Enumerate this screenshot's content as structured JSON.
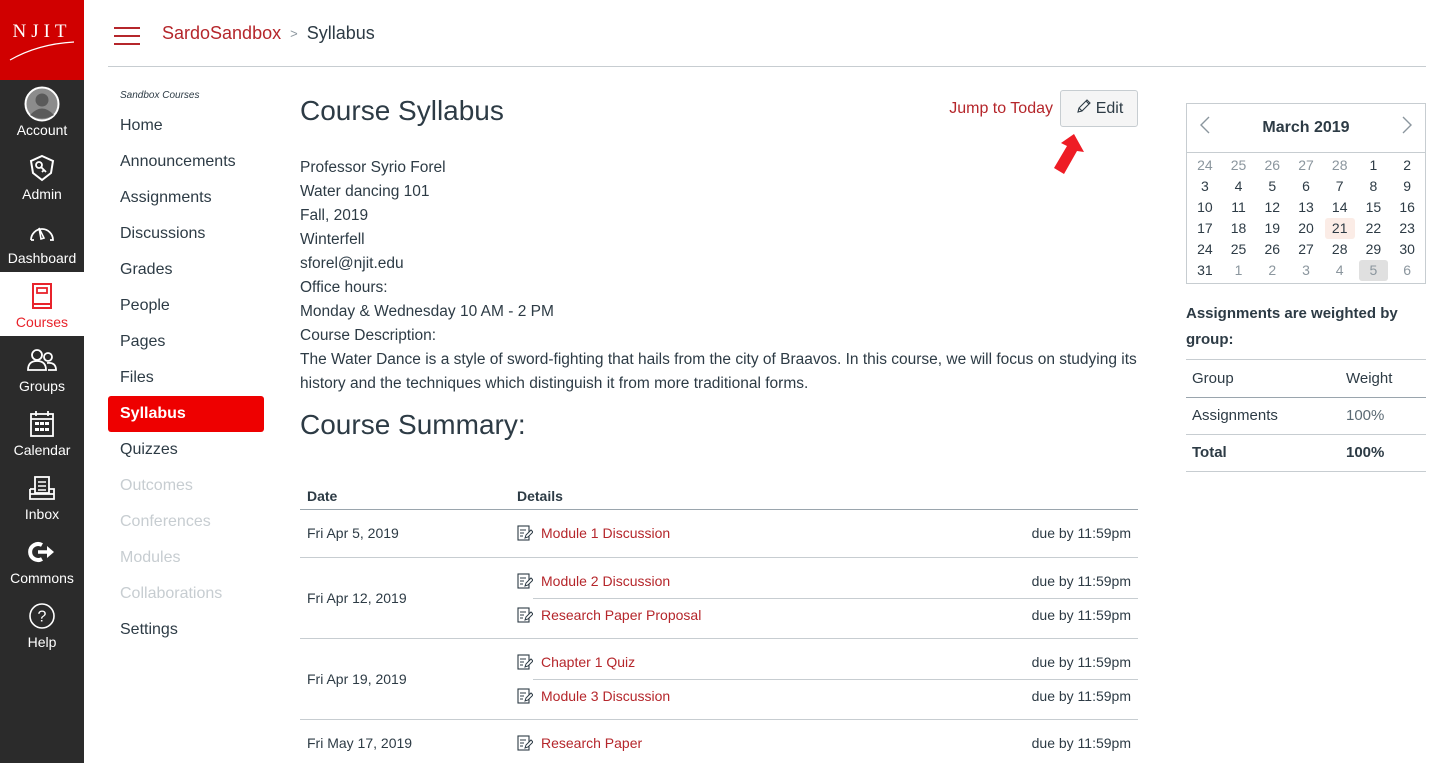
{
  "brand": {
    "logo_text": "NJIT",
    "accent": "#d00000",
    "link_color": "#b5262b",
    "active_nav": "#ee0000"
  },
  "global_nav": [
    {
      "label": "Account",
      "icon": "avatar-icon"
    },
    {
      "label": "Admin",
      "icon": "admin-shield-icon"
    },
    {
      "label": "Dashboard",
      "icon": "dashboard-gauge-icon"
    },
    {
      "label": "Courses",
      "icon": "courses-book-icon",
      "active": true
    },
    {
      "label": "Groups",
      "icon": "groups-icon"
    },
    {
      "label": "Calendar",
      "icon": "calendar-icon"
    },
    {
      "label": "Inbox",
      "icon": "inbox-icon"
    },
    {
      "label": "Commons",
      "icon": "commons-icon"
    },
    {
      "label": "Help",
      "icon": "help-icon"
    }
  ],
  "breadcrumb": {
    "course": "SardoSandbox",
    "separator": ">",
    "current": "Syllabus"
  },
  "course_nav": {
    "term": "Sandbox Courses",
    "items": [
      {
        "label": "Home"
      },
      {
        "label": "Announcements"
      },
      {
        "label": "Assignments"
      },
      {
        "label": "Discussions"
      },
      {
        "label": "Grades"
      },
      {
        "label": "People"
      },
      {
        "label": "Pages"
      },
      {
        "label": "Files"
      },
      {
        "label": "Syllabus",
        "active": true
      },
      {
        "label": "Quizzes"
      },
      {
        "label": "Outcomes",
        "disabled": true
      },
      {
        "label": "Conferences",
        "disabled": true
      },
      {
        "label": "Modules",
        "disabled": true
      },
      {
        "label": "Collaborations",
        "disabled": true
      },
      {
        "label": "Settings"
      }
    ]
  },
  "main": {
    "title": "Course Syllabus",
    "jump_to_today": "Jump to Today",
    "edit_label": "Edit",
    "syllabus_lines": [
      "Professor Syrio Forel",
      "Water dancing 101",
      "Fall, 2019",
      "Winterfell",
      "sforel@njit.edu",
      "Office hours:",
      "Monday & Wednesday 10 AM - 2 PM",
      "Course Description:",
      "The Water Dance is a style of sword-fighting that hails from the city of Braavos. In this course, we will focus on studying its history and the techniques which distinguish it from more traditional forms."
    ],
    "summary_title": "Course Summary:",
    "summary_headers": {
      "date": "Date",
      "details": "Details"
    },
    "summary": [
      {
        "date": "Fri Apr 5, 2019",
        "events": [
          {
            "name": "Module 1 Discussion",
            "due": "due by 11:59pm"
          }
        ]
      },
      {
        "date": "Fri Apr 12, 2019",
        "events": [
          {
            "name": "Module 2 Discussion",
            "due": "due by 11:59pm"
          },
          {
            "name": "Research Paper Proposal",
            "due": "due by 11:59pm"
          }
        ]
      },
      {
        "date": "Fri Apr 19, 2019",
        "events": [
          {
            "name": "Chapter 1 Quiz",
            "due": "due by 11:59pm"
          },
          {
            "name": "Module 3 Discussion",
            "due": "due by 11:59pm"
          }
        ]
      },
      {
        "date": "Fri May 17, 2019",
        "events": [
          {
            "name": "Research Paper",
            "due": "due by 11:59pm"
          }
        ]
      }
    ]
  },
  "calendar": {
    "month_title": "March 2019",
    "prev": "‹",
    "next": "›",
    "today": 21,
    "weeks": [
      [
        {
          "d": "24",
          "o": true
        },
        {
          "d": "25",
          "o": true
        },
        {
          "d": "26",
          "o": true
        },
        {
          "d": "27",
          "o": true
        },
        {
          "d": "28",
          "o": true
        },
        {
          "d": "1"
        },
        {
          "d": "2"
        }
      ],
      [
        {
          "d": "3"
        },
        {
          "d": "4"
        },
        {
          "d": "5"
        },
        {
          "d": "6"
        },
        {
          "d": "7"
        },
        {
          "d": "8"
        },
        {
          "d": "9"
        }
      ],
      [
        {
          "d": "10"
        },
        {
          "d": "11"
        },
        {
          "d": "12"
        },
        {
          "d": "13"
        },
        {
          "d": "14"
        },
        {
          "d": "15"
        },
        {
          "d": "16"
        }
      ],
      [
        {
          "d": "17"
        },
        {
          "d": "18"
        },
        {
          "d": "19"
        },
        {
          "d": "20"
        },
        {
          "d": "21",
          "today": true
        },
        {
          "d": "22"
        },
        {
          "d": "23"
        }
      ],
      [
        {
          "d": "24"
        },
        {
          "d": "25"
        },
        {
          "d": "26"
        },
        {
          "d": "27"
        },
        {
          "d": "28"
        },
        {
          "d": "29"
        },
        {
          "d": "30"
        }
      ],
      [
        {
          "d": "31"
        },
        {
          "d": "1",
          "o": true
        },
        {
          "d": "2",
          "o": true
        },
        {
          "d": "3",
          "o": true
        },
        {
          "d": "4",
          "o": true
        },
        {
          "d": "5",
          "o": true,
          "sel": true
        },
        {
          "d": "6",
          "o": true
        }
      ]
    ]
  },
  "weights": {
    "title": "Assignments are weighted by group:",
    "headers": {
      "group": "Group",
      "weight": "Weight"
    },
    "rows": [
      {
        "group": "Assignments",
        "weight": "100%"
      }
    ],
    "total": {
      "label": "Total",
      "weight": "100%"
    }
  }
}
